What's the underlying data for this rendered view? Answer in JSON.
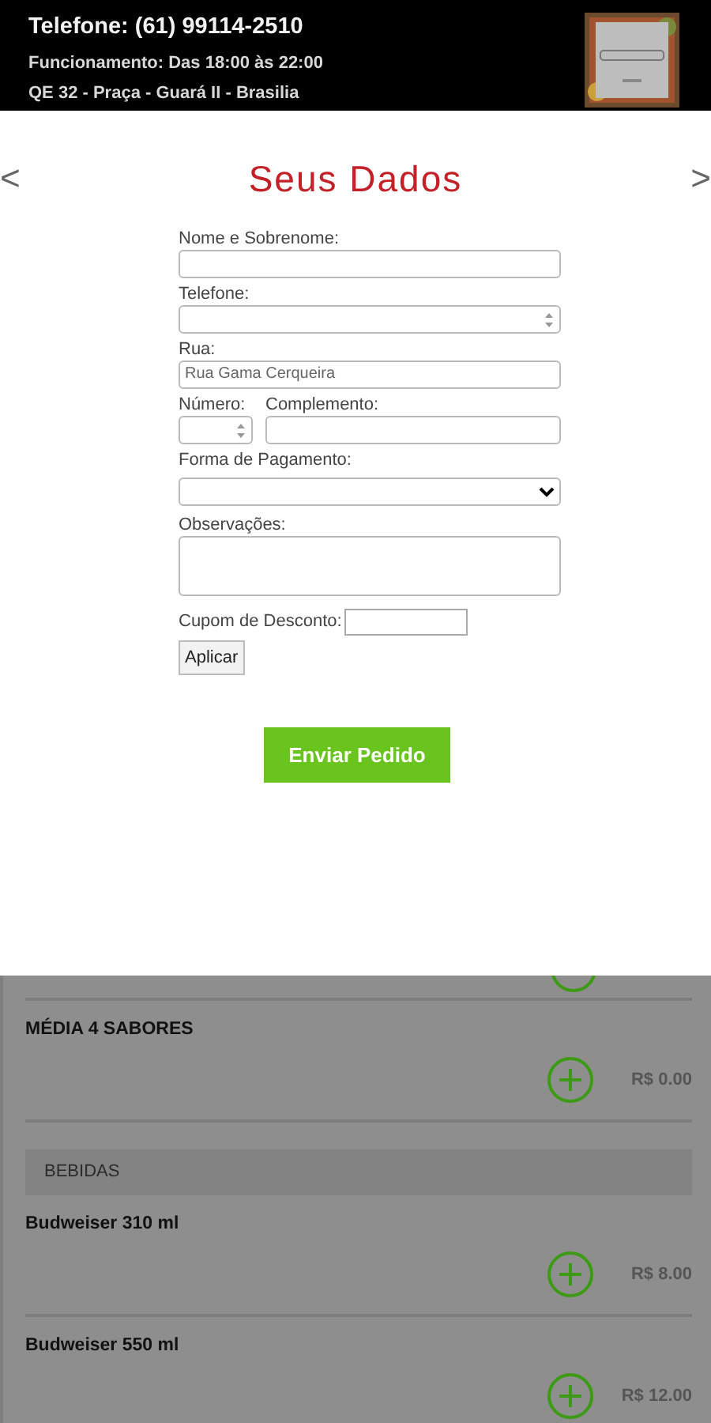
{
  "header": {
    "phone": "Telefone: (61) 99114-2510",
    "hours": "Funcionamento: Das 18:00 às 22:00",
    "address": "QE 32 - Praça - Guará II - Brasilia"
  },
  "nav": {
    "prev": "<",
    "next": ">"
  },
  "modal": {
    "title": "Seus Dados",
    "fields": [
      {
        "kind": "text",
        "label": "Nome e Sobrenome:"
      },
      {
        "kind": "number",
        "label": "Telefone:"
      },
      {
        "kind": "text",
        "label": "Rua:",
        "value": "Rua Gama Cerqueira"
      },
      {
        "kind": "pair",
        "items": [
          {
            "kind": "number",
            "label": "Número:"
          },
          {
            "kind": "text",
            "label": "Complemento:"
          }
        ]
      },
      {
        "kind": "select",
        "label": "Forma de Pagamento:"
      },
      {
        "kind": "textarea",
        "label": "Observações:"
      }
    ],
    "coupon": {
      "label": "Cupom de Desconto:",
      "button": "Aplicar"
    },
    "submit": "Enviar Pedido"
  },
  "menu": [
    {
      "kind": "partial"
    },
    {
      "kind": "product",
      "name": "MÉDIA 4 SABORES",
      "price": "R$ 0.00"
    },
    {
      "kind": "category",
      "name": "BEBIDAS"
    },
    {
      "kind": "product",
      "name": "Budweiser 310 ml",
      "price": "R$ 8.00"
    },
    {
      "kind": "product",
      "name": "Budweiser 550 ml",
      "price": "R$ 12.00"
    }
  ]
}
